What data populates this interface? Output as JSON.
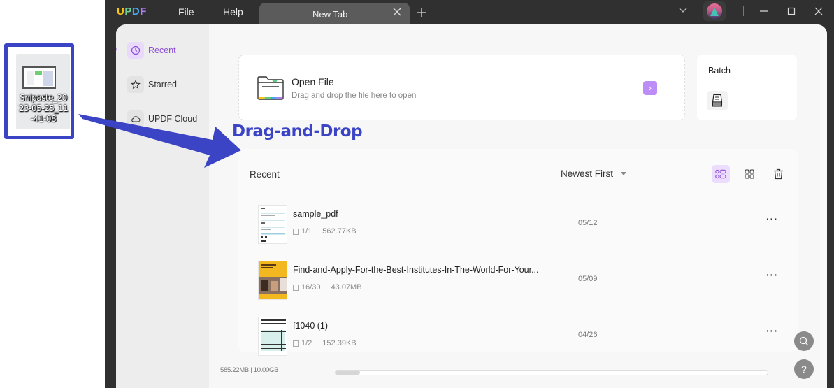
{
  "desktop": {
    "file_name": "Snipaste_2023-05-25_11-41-08"
  },
  "titlebar": {
    "logo": [
      "U",
      "P",
      "D",
      "F"
    ],
    "menu": [
      {
        "label": "File"
      },
      {
        "label": "Help"
      }
    ],
    "tab": {
      "label": "New Tab"
    },
    "icons": {
      "tab_close": "close-icon",
      "new_tab": "plus-icon",
      "dropdown": "chevron-down-icon",
      "minimize": "minimize-icon",
      "maximize": "maximize-icon",
      "close": "close-icon"
    }
  },
  "sidebar": {
    "items": [
      {
        "label": "Recent",
        "icon": "clock-icon",
        "active": true
      },
      {
        "label": "Starred",
        "icon": "star-icon",
        "active": false
      },
      {
        "label": "UPDF Cloud",
        "icon": "cloud-icon",
        "active": false
      }
    ]
  },
  "open_file": {
    "title": "Open File",
    "subtitle": "Drag and drop the file here to open",
    "arrow": "›"
  },
  "batch": {
    "title": "Batch"
  },
  "recent": {
    "title": "Recent",
    "sort_label": "Newest First",
    "files": [
      {
        "name": "sample_pdf",
        "pages": "1/1",
        "size": "562.77KB",
        "date": "05/12",
        "more": "···"
      },
      {
        "name": "Find-and-Apply-For-the-Best-Institutes-In-The-World-For-Your...",
        "pages": "16/30",
        "size": "43.07MB",
        "date": "05/09",
        "more": "···"
      },
      {
        "name": "f1040 (1)",
        "pages": "1/2",
        "size": "152.39KB",
        "date": "04/26",
        "more": "···"
      }
    ]
  },
  "storage": {
    "label": "585.22MB | 10.00GB",
    "used_fraction": 0.057
  },
  "help": {
    "label": "?"
  },
  "annotation": {
    "label": "Drag-and-Drop",
    "color": "#3b44c5"
  },
  "colors": {
    "accent": "#8e4fd6",
    "accent_light": "#ecdcfd",
    "annotation": "#3b44c5"
  }
}
